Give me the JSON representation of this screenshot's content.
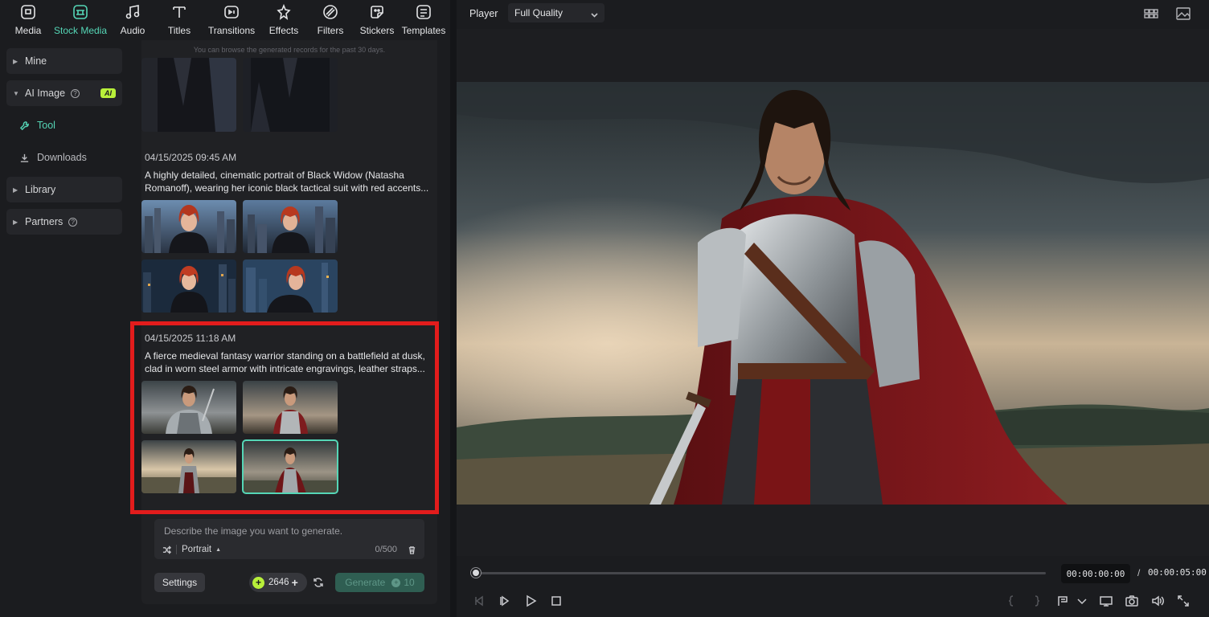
{
  "toolbar": {
    "items": [
      {
        "label": "Media",
        "icon": "media-icon"
      },
      {
        "label": "Stock Media",
        "icon": "stock-media-icon",
        "active": true
      },
      {
        "label": "Audio",
        "icon": "music-note-icon"
      },
      {
        "label": "Titles",
        "icon": "text-t-icon"
      },
      {
        "label": "Transitions",
        "icon": "transitions-icon"
      },
      {
        "label": "Effects",
        "icon": "effects-sparkle-icon"
      },
      {
        "label": "Filters",
        "icon": "filters-icon"
      },
      {
        "label": "Stickers",
        "icon": "sticker-icon"
      },
      {
        "label": "Templates",
        "icon": "templates-icon"
      }
    ]
  },
  "leftnav": {
    "mine": "Mine",
    "ai_image": "AI Image",
    "ai_badge": "AI",
    "tool": "Tool",
    "downloads": "Downloads",
    "library": "Library",
    "partners": "Partners"
  },
  "records": {
    "hint": "You can browse the generated records for the past 30 days.",
    "items": [
      {
        "date": "04/15/2025 09:45 AM",
        "description": "A highly detailed, cinematic portrait of Black Widow (Natasha Romanoff), wearing her iconic black tactical suit with red accents..."
      },
      {
        "date": "04/15/2025 11:18 AM",
        "description": "A fierce medieval fantasy warrior standing on a battlefield at dusk, clad in worn steel armor with intricate engravings, leather straps..."
      }
    ]
  },
  "prompt": {
    "placeholder": "Describe the image you want to generate.",
    "aspect": "Portrait",
    "count": "0/500"
  },
  "actions": {
    "settings": "Settings",
    "credits": "2646",
    "generate": "Generate",
    "generate_cost": "10"
  },
  "player": {
    "title": "Player",
    "quality": "Full Quality",
    "current_time": "00:00:00:00",
    "separator": "/",
    "total_time": "00:00:05:00",
    "progress": 0
  },
  "colors": {
    "accent": "#55d6b6",
    "credit_badge": "#b8f03a",
    "highlight_box": "#e21c1c"
  }
}
